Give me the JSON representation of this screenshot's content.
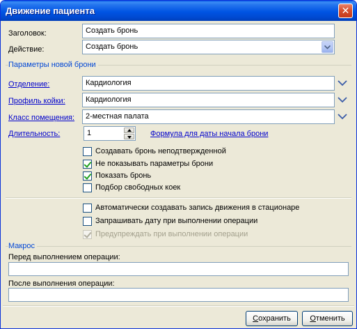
{
  "window": {
    "title": "Движение пациента",
    "close_glyph": "✕"
  },
  "header": {
    "title_label": "Заголовок:",
    "title_value": "Создать бронь",
    "action_label": "Действие:",
    "action_value": "Создать бронь"
  },
  "booking_group": {
    "label": "Параметры новой брони",
    "department_label": "Отделение:",
    "department_value": "Кардиология",
    "bed_profile_label": "Профиль койки:",
    "bed_profile_value": "Кардиология",
    "room_class_label": "Класс помещения:",
    "room_class_value": "2-местная палата",
    "duration_label": "Длительность:",
    "duration_value": "1",
    "formula_link": "Формула для даты начала брони",
    "checkboxes": [
      {
        "label": "Создавать бронь неподтвержденной",
        "checked": false
      },
      {
        "label": "Не показывать параметры брони",
        "checked": true
      },
      {
        "label": "Показать бронь",
        "checked": true
      },
      {
        "label": "Подбор свободных коек",
        "checked": false
      }
    ]
  },
  "options": [
    {
      "label": "Автоматически создавать запись движения в стационаре",
      "checked": false,
      "disabled": false
    },
    {
      "label": "Запрашивать дату при выполнении операции",
      "checked": false,
      "disabled": false
    },
    {
      "label": "Предупреждать при выполнении операции",
      "checked": true,
      "disabled": true
    }
  ],
  "macro_group": {
    "label": "Макрос",
    "before_label": "Перед выполнением операции:",
    "before_value": "",
    "after_label": "После выполнения операции:",
    "after_value": ""
  },
  "buttons": {
    "save_label_underlined": "С",
    "save_label_rest": "охранить",
    "cancel_label_underlined": "О",
    "cancel_label_rest": "тменить"
  },
  "colors": {
    "link": "#0000cc",
    "group_title": "#0046d5",
    "titlebar": "#0054e3"
  }
}
